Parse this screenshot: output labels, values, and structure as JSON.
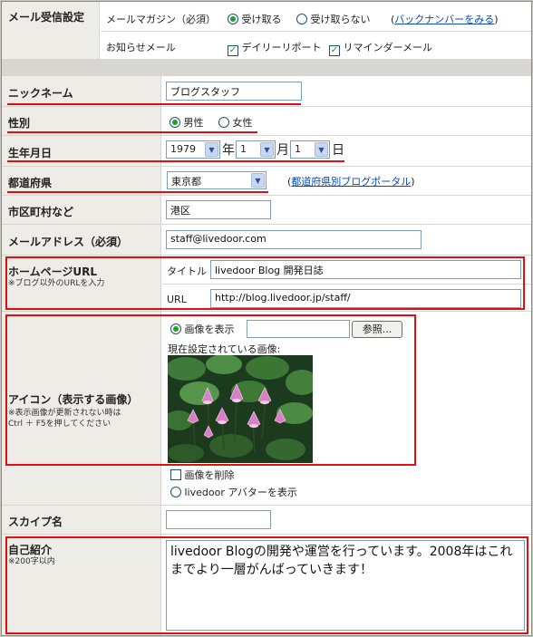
{
  "mail": {
    "label": "メール受信設定",
    "magazine_label": "メールマガジン（必須）",
    "magazine_opt_receive": "受け取る",
    "magazine_opt_decline": "受け取らない",
    "backnumber_link": "バックナンバーをみる",
    "notice_label": "お知らせメール",
    "daily_report": "デイリーリポート",
    "reminder": "リマインダーメール"
  },
  "nickname": {
    "label": "ニックネーム",
    "value": "ブログスタッフ"
  },
  "gender": {
    "label": "性別",
    "male": "男性",
    "female": "女性",
    "selected": "male"
  },
  "birthday": {
    "label": "生年月日",
    "year": "1979",
    "year_unit": "年",
    "month": "1",
    "month_unit": "月",
    "day": "1",
    "day_unit": "日"
  },
  "prefecture": {
    "label": "都道府県",
    "value": "東京都",
    "portal_link": "都道府県別ブログポータル"
  },
  "city": {
    "label": "市区町村など",
    "value": "港区"
  },
  "email": {
    "label": "メールアドレス（必須）",
    "value": "staff@livedoor.com"
  },
  "homepage": {
    "label": "ホームページURL",
    "note": "※ブログ以外のURLを入力",
    "title_label": "タイトル",
    "title_value": "livedoor Blog 開発日誌",
    "url_label": "URL",
    "url_value": "http://blog.livedoor.jp/staff/"
  },
  "icon": {
    "label": "アイコン（表示する画像）",
    "note_line1": "※表示画像が更新されない時は",
    "note_line2": "Ctrl ＋ F5を押してください",
    "show_image": "画像を表示",
    "browse": "参照...",
    "current_image_label": "現在設定されている画像:",
    "delete_image": "画像を削除",
    "avatar": "livedoor アバターを表示"
  },
  "skype": {
    "label": "スカイプ名",
    "value": ""
  },
  "intro": {
    "label": "自己紹介",
    "note": "※200字以内",
    "value": "livedoor Blogの開発や運営を行っています。2008年はこれまでより一層がんばっていきます！"
  }
}
